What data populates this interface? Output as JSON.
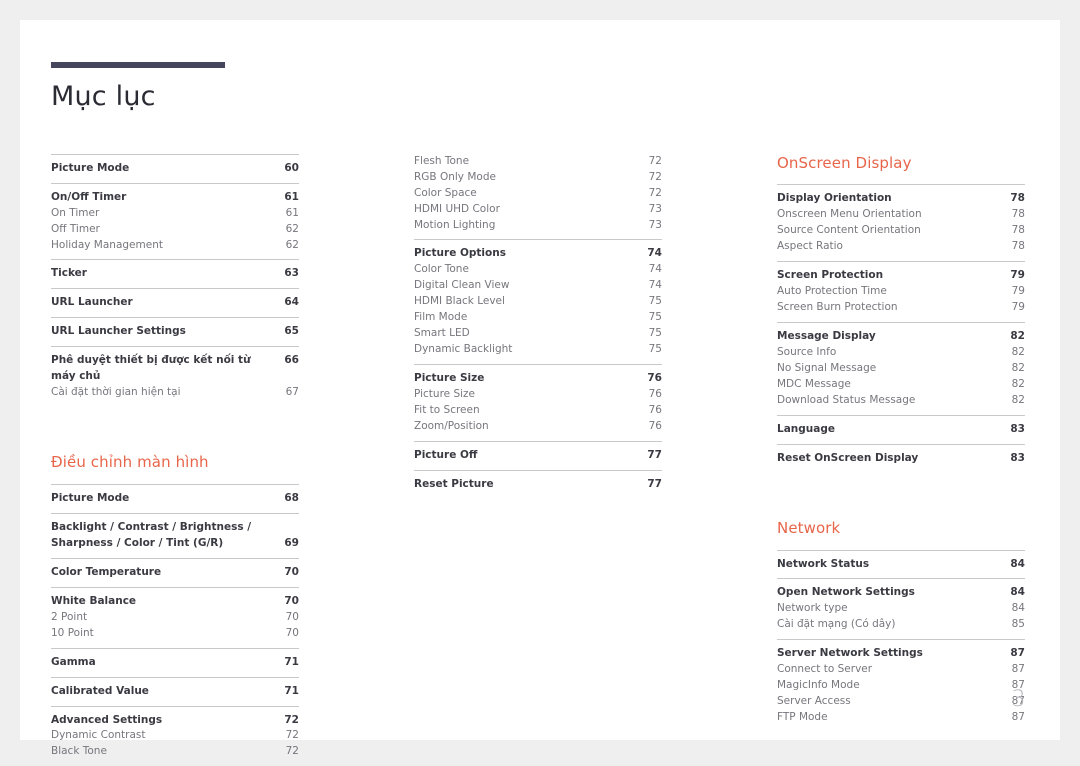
{
  "document": {
    "title": "Mục lục",
    "page_number": "3",
    "accent_color": "#e8654a",
    "rule_color": "#45455c"
  },
  "columns": [
    {
      "id": "column-1",
      "heading": null,
      "groups": [
        {
          "rule": true,
          "rows": [
            {
              "label": "Picture Mode",
              "page": "60",
              "level": 1
            }
          ]
        },
        {
          "rule": true,
          "rows": [
            {
              "label": "On/Off Timer",
              "page": "61",
              "level": 1
            },
            {
              "label": "On Timer",
              "page": "61",
              "level": 2
            },
            {
              "label": "Off Timer",
              "page": "62",
              "level": 2
            },
            {
              "label": "Holiday Management",
              "page": "62",
              "level": 2
            }
          ]
        },
        {
          "rule": true,
          "rows": [
            {
              "label": "Ticker",
              "page": "63",
              "level": 1
            }
          ]
        },
        {
          "rule": true,
          "rows": [
            {
              "label": "URL Launcher",
              "page": "64",
              "level": 1
            }
          ]
        },
        {
          "rule": true,
          "rows": [
            {
              "label": "URL Launcher Settings",
              "page": "65",
              "level": 1
            }
          ]
        },
        {
          "rule": true,
          "rows": [
            {
              "label": "Phê duyệt thiết bị được kết nối từ máy chủ",
              "page": "66",
              "level": 1
            },
            {
              "label": "Cài đặt thời gian hiện tại",
              "page": "67",
              "level": 2
            }
          ]
        }
      ],
      "second_heading": "Điều chỉnh màn hình",
      "second_groups": [
        {
          "rule": true,
          "rows": [
            {
              "label": "Picture Mode",
              "page": "68",
              "level": 1
            }
          ]
        },
        {
          "rule": true,
          "rows": [
            {
              "label": "Backlight / Contrast / Brightness / Sharpness / Color / Tint (G/R)",
              "page": "69",
              "level": 1,
              "wrap": true
            }
          ]
        },
        {
          "rule": true,
          "rows": [
            {
              "label": "Color Temperature",
              "page": "70",
              "level": 1
            }
          ]
        },
        {
          "rule": true,
          "rows": [
            {
              "label": "White Balance",
              "page": "70",
              "level": 1
            },
            {
              "label": "2 Point",
              "page": "70",
              "level": 2
            },
            {
              "label": "10 Point",
              "page": "70",
              "level": 2
            }
          ]
        },
        {
          "rule": true,
          "rows": [
            {
              "label": "Gamma",
              "page": "71",
              "level": 1
            }
          ]
        },
        {
          "rule": true,
          "rows": [
            {
              "label": "Calibrated Value",
              "page": "71",
              "level": 1
            }
          ]
        },
        {
          "rule": true,
          "rows": [
            {
              "label": "Advanced Settings",
              "page": "72",
              "level": 1
            },
            {
              "label": "Dynamic Contrast",
              "page": "72",
              "level": 2
            },
            {
              "label": "Black Tone",
              "page": "72",
              "level": 2
            }
          ]
        }
      ]
    },
    {
      "id": "column-2",
      "heading": null,
      "groups": [
        {
          "rule": false,
          "rows": [
            {
              "label": "Flesh Tone",
              "page": "72",
              "level": 2
            },
            {
              "label": "RGB Only Mode",
              "page": "72",
              "level": 2
            },
            {
              "label": "Color Space",
              "page": "72",
              "level": 2
            },
            {
              "label": "HDMI UHD Color",
              "page": "73",
              "level": 2
            },
            {
              "label": "Motion Lighting",
              "page": "73",
              "level": 2
            }
          ]
        },
        {
          "rule": true,
          "rows": [
            {
              "label": "Picture Options",
              "page": "74",
              "level": 1
            },
            {
              "label": "Color Tone",
              "page": "74",
              "level": 2
            },
            {
              "label": "Digital Clean View",
              "page": "74",
              "level": 2
            },
            {
              "label": "HDMI Black Level",
              "page": "75",
              "level": 2
            },
            {
              "label": "Film Mode",
              "page": "75",
              "level": 2
            },
            {
              "label": "Smart LED",
              "page": "75",
              "level": 2
            },
            {
              "label": "Dynamic Backlight",
              "page": "75",
              "level": 2
            }
          ]
        },
        {
          "rule": true,
          "rows": [
            {
              "label": "Picture Size",
              "page": "76",
              "level": 1
            },
            {
              "label": "Picture Size",
              "page": "76",
              "level": 2
            },
            {
              "label": "Fit to Screen",
              "page": "76",
              "level": 2
            },
            {
              "label": "Zoom/Position",
              "page": "76",
              "level": 2
            }
          ]
        },
        {
          "rule": true,
          "rows": [
            {
              "label": "Picture Off",
              "page": "77",
              "level": 1
            }
          ]
        },
        {
          "rule": true,
          "rows": [
            {
              "label": "Reset Picture",
              "page": "77",
              "level": 1
            }
          ]
        }
      ],
      "second_heading": null,
      "second_groups": []
    },
    {
      "id": "column-3",
      "heading": "OnScreen Display",
      "groups": [
        {
          "rule": true,
          "rows": [
            {
              "label": "Display Orientation",
              "page": "78",
              "level": 1
            },
            {
              "label": "Onscreen Menu Orientation",
              "page": "78",
              "level": 2
            },
            {
              "label": "Source Content Orientation",
              "page": "78",
              "level": 2
            },
            {
              "label": "Aspect Ratio",
              "page": "78",
              "level": 2
            }
          ]
        },
        {
          "rule": true,
          "rows": [
            {
              "label": "Screen Protection",
              "page": "79",
              "level": 1
            },
            {
              "label": "Auto Protection Time",
              "page": "79",
              "level": 2
            },
            {
              "label": "Screen Burn Protection",
              "page": "79",
              "level": 2
            }
          ]
        },
        {
          "rule": true,
          "rows": [
            {
              "label": "Message Display",
              "page": "82",
              "level": 1
            },
            {
              "label": "Source Info",
              "page": "82",
              "level": 2
            },
            {
              "label": "No Signal Message",
              "page": "82",
              "level": 2
            },
            {
              "label": "MDC Message",
              "page": "82",
              "level": 2
            },
            {
              "label": "Download Status Message",
              "page": "82",
              "level": 2
            }
          ]
        },
        {
          "rule": true,
          "rows": [
            {
              "label": "Language",
              "page": "83",
              "level": 1
            }
          ]
        },
        {
          "rule": true,
          "rows": [
            {
              "label": "Reset OnScreen Display",
              "page": "83",
              "level": 1
            }
          ]
        }
      ],
      "second_heading": "Network",
      "second_groups": [
        {
          "rule": true,
          "rows": [
            {
              "label": "Network Status",
              "page": "84",
              "level": 1
            }
          ]
        },
        {
          "rule": true,
          "rows": [
            {
              "label": "Open Network Settings",
              "page": "84",
              "level": 1
            },
            {
              "label": "Network type",
              "page": "84",
              "level": 2
            },
            {
              "label": "Cài đặt mạng (Có dây)",
              "page": "85",
              "level": 2
            }
          ]
        },
        {
          "rule": true,
          "rows": [
            {
              "label": "Server Network Settings",
              "page": "87",
              "level": 1
            },
            {
              "label": "Connect to Server",
              "page": "87",
              "level": 2
            },
            {
              "label": "MagicInfo Mode",
              "page": "87",
              "level": 2
            },
            {
              "label": "Server Access",
              "page": "87",
              "level": 2
            },
            {
              "label": "FTP Mode",
              "page": "87",
              "level": 2
            }
          ]
        }
      ]
    }
  ]
}
